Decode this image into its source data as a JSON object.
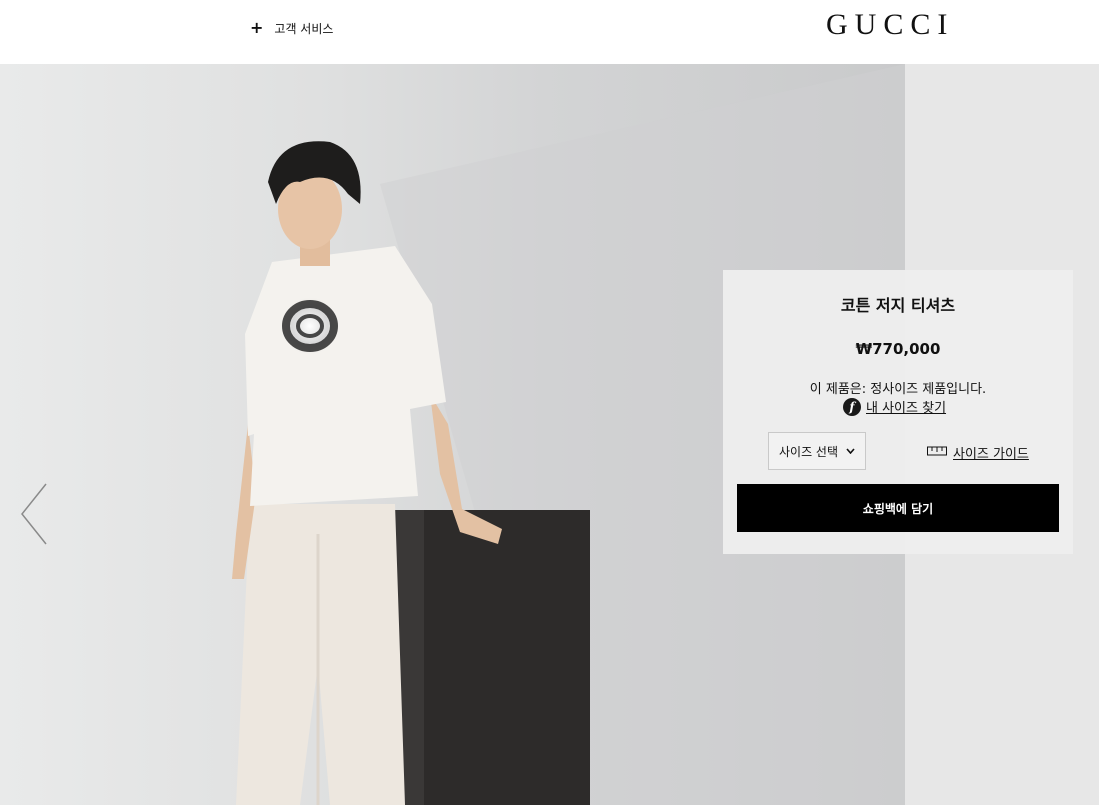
{
  "header": {
    "customer_service_label": "고객 서비스",
    "plus_glyph": "+",
    "logo": "GUCCI"
  },
  "product": {
    "title": "코튼 저지 티셔츠",
    "price": "₩770,000",
    "fit_note": "이 제품은: 정사이즈 제품입니다.",
    "find_my_size_label": "내 사이즈 찾기",
    "size_select_label": "사이즈 선택",
    "size_guide_label": "사이즈 가이드",
    "add_to_bag_label": "쇼핑백에 담기"
  },
  "icons": {
    "find_size_badge": "f",
    "prev_arrow": "chevron-left-icon",
    "size_guide": "ruler-icon",
    "select_chevron": "chevron-down-icon"
  },
  "colors": {
    "accent": "#000000",
    "panel_bg": "#eeeeee"
  }
}
